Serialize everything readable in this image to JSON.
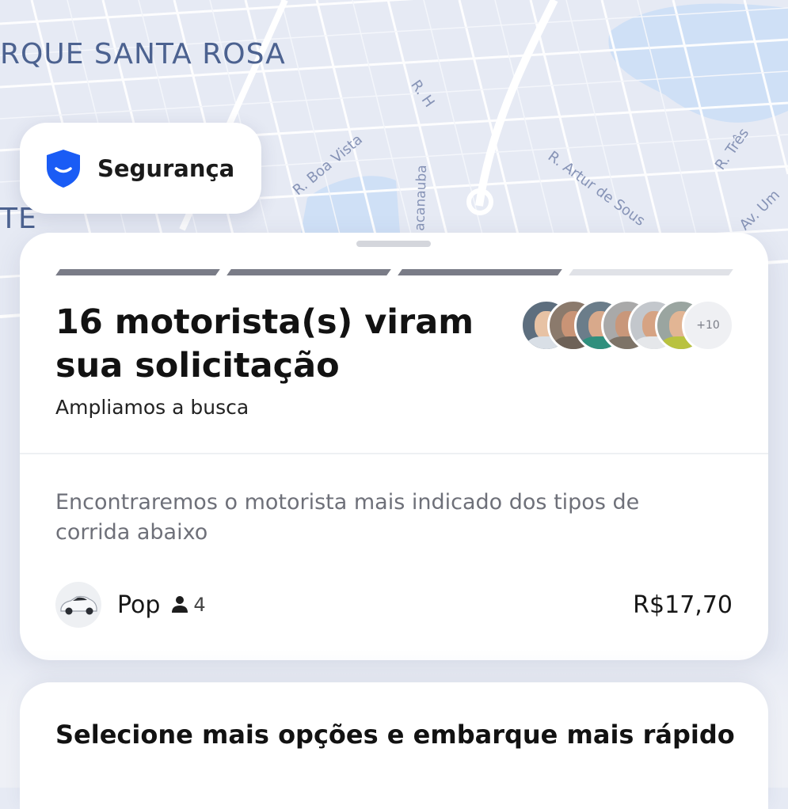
{
  "map": {
    "area_label_1": "RQUE SANTA ROSA",
    "area_label_2": "TE",
    "streets": [
      "R. H",
      "R. Boa Vista",
      "acanauba",
      "R. Artur de Sous",
      "R. Três",
      "Av. Um"
    ]
  },
  "safety_button": {
    "label": "Segurança",
    "icon": "shield-smile-icon",
    "icon_color": "#1a5cf5"
  },
  "sheet": {
    "progress": {
      "segments_total": 4,
      "segments_completed": 3
    },
    "title": "16 motorista(s) viram sua solicitação",
    "subtitle": "Ampliamos a busca",
    "avatars": {
      "count_shown": 6,
      "more_label": "+10"
    },
    "info_text": "Encontraremos o motorista mais indicado dos tipos de corrida abaixo",
    "ride": {
      "name": "Pop",
      "seats": "4",
      "price": "R$17,70",
      "car_icon": "car-icon",
      "seat_icon": "person-icon"
    }
  },
  "more_options": {
    "title": "Selecione mais opções e embarque mais rápido"
  },
  "colors": {
    "map_bg": "#e6eaf4",
    "map_water": "#cfe0f6",
    "accent": "#1a5cf5",
    "progress": "#7a7c87"
  }
}
